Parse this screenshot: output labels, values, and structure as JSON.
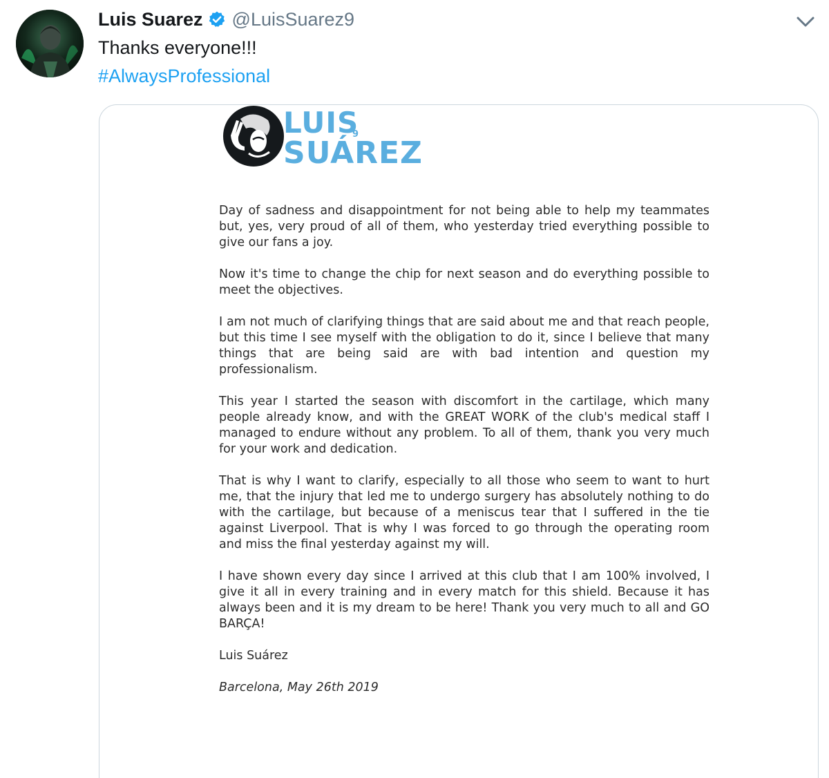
{
  "tweet": {
    "display_name": "Luis Suarez",
    "handle": "@LuisSuarez9",
    "text": "Thanks everyone!!!",
    "hashtag": "#AlwaysProfessional",
    "verified": true,
    "menu_icon": "chevron-down-icon"
  },
  "letter": {
    "paragraphs": [
      "Day of sadness and disappointment for not being able to help my teammates but, yes, very proud of all of them, who yesterday tried everything possible to give our fans a joy.",
      "Now it's time to change the chip for next season and do everything possible to meet the objectives.",
      "I am not much of clarifying things that are said about me and that reach people, but this time I see myself with the obligation to do it, since I believe that many things that are being said are with bad intention and question my professionalism.",
      "This year I started the season with discomfort in the cartilage, which many people already know, and with the GREAT WORK of the club's medical staff I managed to endure without any problem. To all of them, thank you very much for your work and dedication.",
      "That is why I want to clarify, especially to all those who seem to want to hurt me, that the injury that led me to undergo surgery has absolutely nothing to do with the cartilage, but because of a meniscus tear that I suffered in the tie against Liverpool. That is why I was forced to go through the operating room and miss the final yesterday against my will.",
      "I have shown every day since I arrived at this club that I am 100% involved, I give it all in every training and in every match for this shield. Because it has always been and it is my dream to be here! Thank you very much to all and GO BARÇA!"
    ],
    "signature_name": "Luis Suárez",
    "signature_place_date": "Barcelona, May 26th 2019"
  },
  "logo": {
    "line1": "LUIS",
    "line2": "SUÁREZ",
    "number": "9"
  },
  "colors": {
    "link": "#1da1f2",
    "verified": "#1da1f2",
    "logo_text": "#5aaedf",
    "muted": "#657786",
    "card_border": "#ccd6dd"
  }
}
